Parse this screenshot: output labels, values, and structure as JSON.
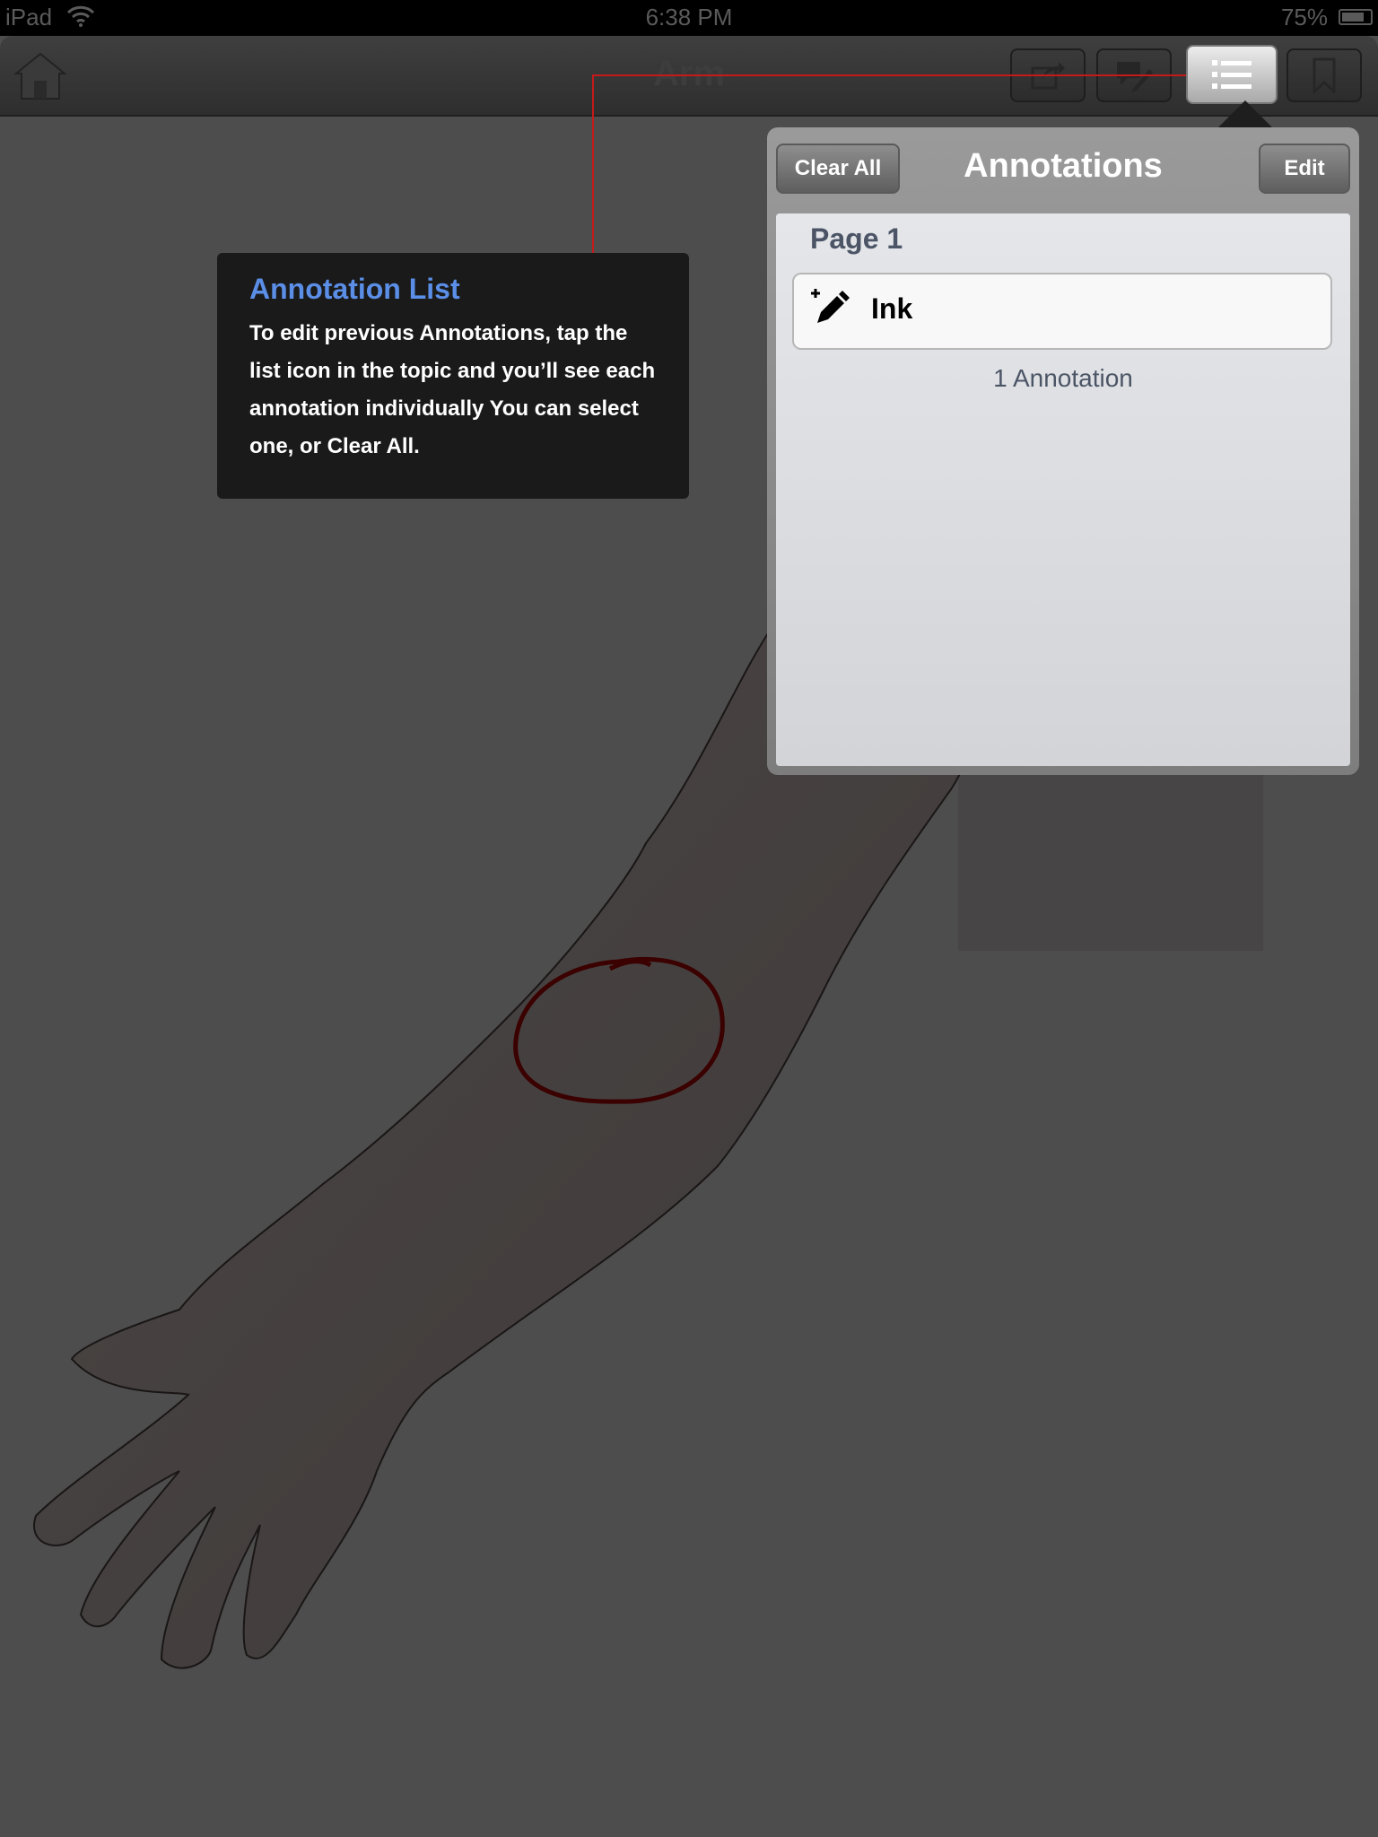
{
  "status_bar": {
    "carrier": "iPad",
    "time": "6:38 PM",
    "battery": "75%"
  },
  "nav": {
    "title": "Arm",
    "icons": [
      "home-icon",
      "share-icon",
      "annotate-icon",
      "list-icon",
      "bookmark-icon"
    ]
  },
  "tooltip": {
    "title": "Annotation List",
    "body": "To edit previous Annotations, tap the list icon in the topic and you’ll see each annotation individually You can select one, or Clear All."
  },
  "popover": {
    "title": "Annotations",
    "clear_all_label": "Clear All",
    "edit_label": "Edit",
    "section_header": "Page 1",
    "items": [
      {
        "label": "Ink",
        "icon": "ink-pen-icon"
      }
    ],
    "count_label": "1 Annotation"
  },
  "colors": {
    "background": "#4d4d4d",
    "tooltip_title": "#5b8ee6",
    "leader_line": "#c41a1a",
    "ink_annotation": "#3b0000"
  }
}
